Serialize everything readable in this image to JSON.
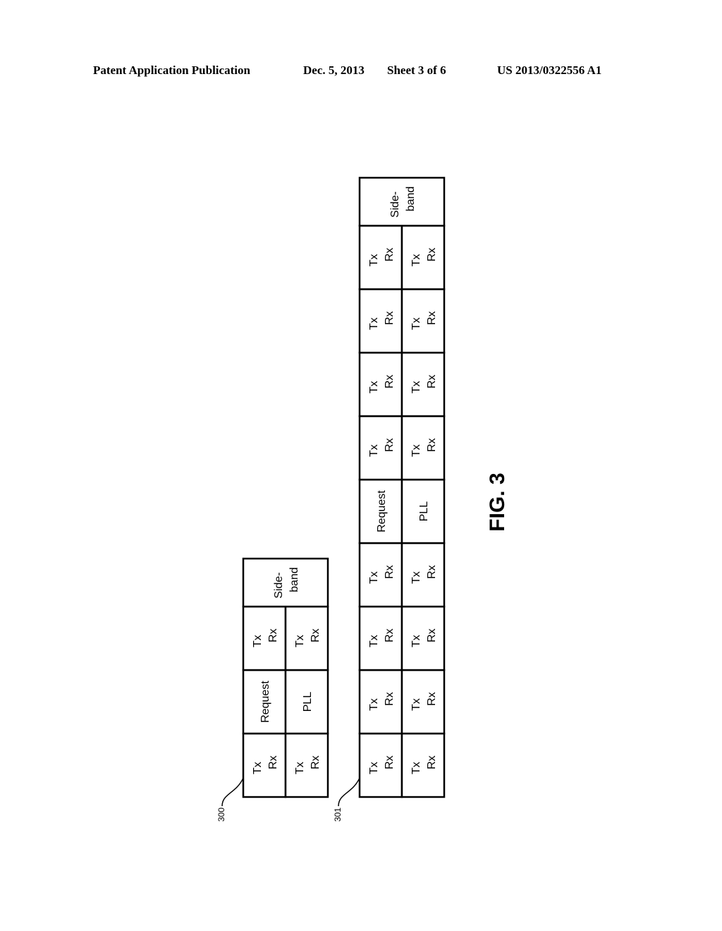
{
  "header": {
    "publication": "Patent Application Publication",
    "date": "Dec. 5, 2013",
    "sheet": "Sheet 3 of 6",
    "number": "US 2013/0322556 A1"
  },
  "figure_label": "FIG. 3",
  "diagrams": [
    {
      "ref": "300",
      "columns": [
        {
          "type": "split",
          "top": [
            "Tx",
            "Rx"
          ],
          "bottom": [
            "Tx",
            "Rx"
          ]
        },
        {
          "type": "split",
          "top": [
            "Request"
          ],
          "bottom": [
            "PLL"
          ]
        },
        {
          "type": "split",
          "top": [
            "Tx",
            "Rx"
          ],
          "bottom": [
            "Tx",
            "Rx"
          ]
        },
        {
          "type": "full",
          "text": [
            "Side-",
            "band"
          ]
        }
      ]
    },
    {
      "ref": "301",
      "columns": [
        {
          "type": "split",
          "top": [
            "Tx",
            "Rx"
          ],
          "bottom": [
            "Tx",
            "Rx"
          ]
        },
        {
          "type": "split",
          "top": [
            "Tx",
            "Rx"
          ],
          "bottom": [
            "Tx",
            "Rx"
          ]
        },
        {
          "type": "split",
          "top": [
            "Tx",
            "Rx"
          ],
          "bottom": [
            "Tx",
            "Rx"
          ]
        },
        {
          "type": "split",
          "top": [
            "Tx",
            "Rx"
          ],
          "bottom": [
            "Tx",
            "Rx"
          ]
        },
        {
          "type": "split",
          "top": [
            "Request"
          ],
          "bottom": [
            "PLL"
          ]
        },
        {
          "type": "split",
          "top": [
            "Tx",
            "Rx"
          ],
          "bottom": [
            "Tx",
            "Rx"
          ]
        },
        {
          "type": "split",
          "top": [
            "Tx",
            "Rx"
          ],
          "bottom": [
            "Tx",
            "Rx"
          ]
        },
        {
          "type": "split",
          "top": [
            "Tx",
            "Rx"
          ],
          "bottom": [
            "Tx",
            "Rx"
          ]
        },
        {
          "type": "split",
          "top": [
            "Tx",
            "Rx"
          ],
          "bottom": [
            "Tx",
            "Rx"
          ]
        },
        {
          "type": "full",
          "text": [
            "Side-",
            "band"
          ]
        }
      ]
    }
  ]
}
